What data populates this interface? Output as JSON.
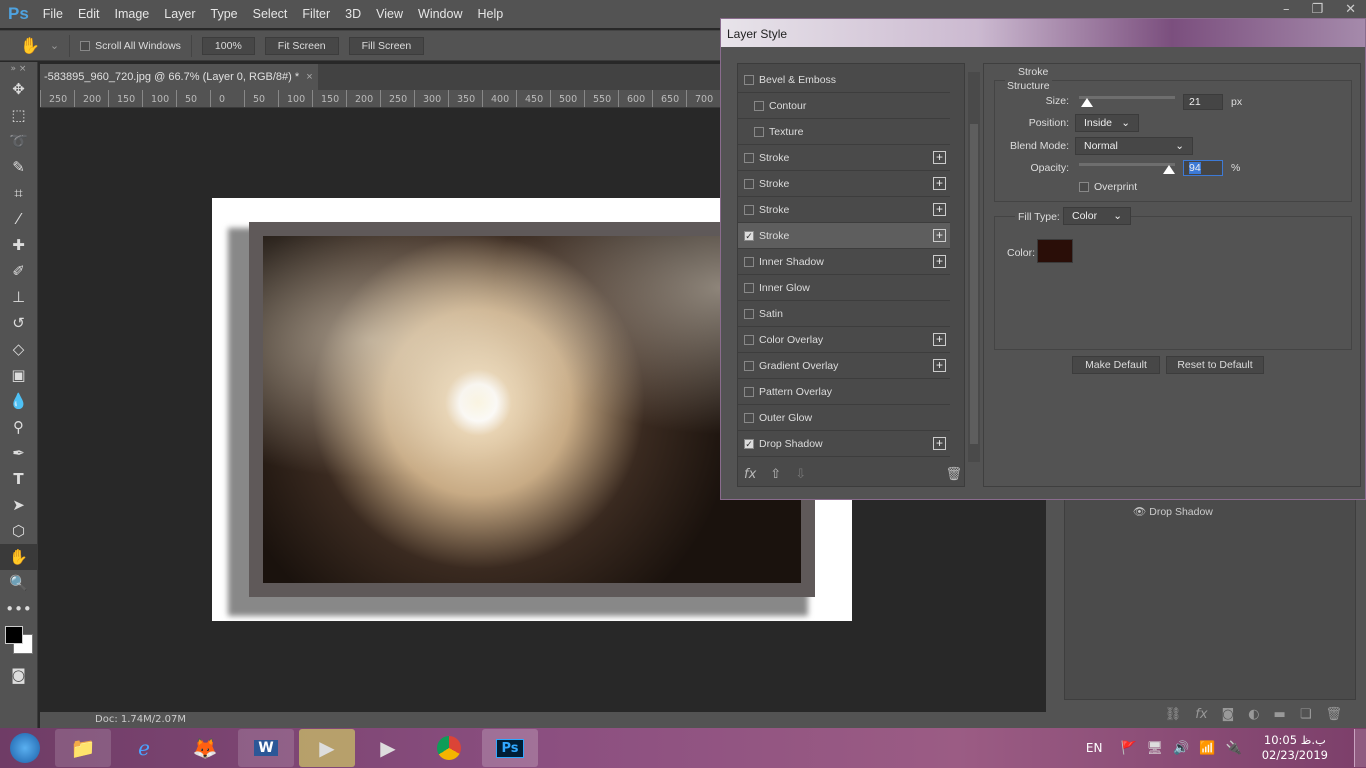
{
  "app": {
    "logo": "Ps",
    "menu": [
      "File",
      "Edit",
      "Image",
      "Layer",
      "Type",
      "Select",
      "Filter",
      "3D",
      "View",
      "Window",
      "Help"
    ]
  },
  "options": {
    "scroll_all": "Scroll All Windows",
    "zoom100": "100%",
    "fit": "Fit Screen",
    "fill": "Fill Screen"
  },
  "document": {
    "tab": "-583895_960_720.jpg @ 66.7% (Layer 0, RGB/8#) *",
    "status": "Doc: 1.74M/2.07M"
  },
  "ruler": [
    "250",
    "200",
    "150",
    "100",
    "50",
    "0",
    "50",
    "100",
    "150",
    "200",
    "250",
    "300",
    "350",
    "400",
    "450",
    "500",
    "550",
    "600",
    "650",
    "700"
  ],
  "layers": {
    "effect": "Drop Shadow"
  },
  "dialog": {
    "title": "Layer Style",
    "styles": [
      {
        "label": "Bevel & Emboss",
        "checked": false,
        "plus": false,
        "sub": false
      },
      {
        "label": "Contour",
        "checked": false,
        "plus": false,
        "sub": true
      },
      {
        "label": "Texture",
        "checked": false,
        "plus": false,
        "sub": true
      },
      {
        "label": "Stroke",
        "checked": false,
        "plus": true,
        "sub": false
      },
      {
        "label": "Stroke",
        "checked": false,
        "plus": true,
        "sub": false
      },
      {
        "label": "Stroke",
        "checked": false,
        "plus": true,
        "sub": false
      },
      {
        "label": "Stroke",
        "checked": true,
        "plus": true,
        "sub": false,
        "selected": true
      },
      {
        "label": "Inner Shadow",
        "checked": false,
        "plus": true,
        "sub": false
      },
      {
        "label": "Inner Glow",
        "checked": false,
        "plus": false,
        "sub": false
      },
      {
        "label": "Satin",
        "checked": false,
        "plus": false,
        "sub": false
      },
      {
        "label": "Color Overlay",
        "checked": false,
        "plus": true,
        "sub": false
      },
      {
        "label": "Gradient Overlay",
        "checked": false,
        "plus": true,
        "sub": false
      },
      {
        "label": "Pattern Overlay",
        "checked": false,
        "plus": false,
        "sub": false
      },
      {
        "label": "Outer Glow",
        "checked": false,
        "plus": false,
        "sub": false
      },
      {
        "label": "Drop Shadow",
        "checked": true,
        "plus": true,
        "sub": false
      }
    ],
    "stroke": {
      "heading": "Stroke",
      "structure": "Structure",
      "size_label": "Size:",
      "size": "21",
      "size_unit": "px",
      "size_fraction": 0.08,
      "position_label": "Position:",
      "position": "Inside",
      "blend_label": "Blend Mode:",
      "blend": "Normal",
      "opacity_label": "Opacity:",
      "opacity": "94",
      "opacity_unit": "%",
      "overprint": "Overprint",
      "filltype_label": "Fill Type:",
      "filltype": "Color",
      "color_label": "Color:",
      "color": "#2a0e08",
      "make_default": "Make Default",
      "reset_default": "Reset to Default"
    }
  },
  "taskbar": {
    "lang": "EN",
    "time": "10:05 ب.ظ",
    "date": "02/23/2019"
  }
}
